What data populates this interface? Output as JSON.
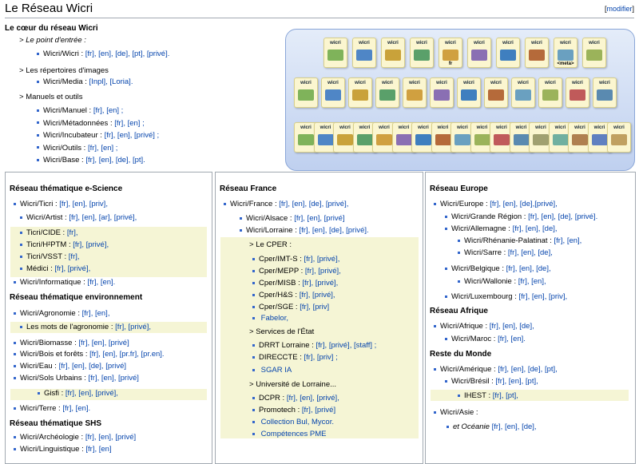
{
  "page": {
    "title": "Le Réseau Wicri",
    "edit_link": "modifier"
  },
  "coeur": {
    "heading": "Le cœur du réseau Wicri",
    "point_label": "Le point d'entrée :",
    "point_items": [
      {
        "name": "Wicri/Wicri :",
        "links": "[fr], [en], [de], [pt], [privé]."
      }
    ],
    "images_label": "Les répertoires d'images",
    "images_items": [
      {
        "name": "Wicri/Media :",
        "links": "[Inpl], [Loria]."
      }
    ],
    "manuels_label": "Manuels et outils",
    "manuels_items": [
      {
        "name": "Wicri/Manuel :",
        "links": "[fr], [en] ;"
      },
      {
        "name": "Wicri/Métadonnées :",
        "links": "[fr], [en] ;"
      },
      {
        "name": "Wicri/Incubateur :",
        "links": "[fr], [en], [privé] ;"
      },
      {
        "name": "Wicri/Outils :",
        "links": "[fr], [en] ;"
      },
      {
        "name": "Wicri/Base :",
        "links": "[fr], [en], [de], [pt]."
      }
    ]
  },
  "collage": {
    "tile_text": "wicri",
    "tile_count": 42,
    "row1_labels": [
      "",
      "",
      "",
      "",
      "fr",
      "",
      "",
      "",
      "<meta>",
      ""
    ],
    "row2_labels": [
      "",
      "",
      "",
      "",
      "",
      "",
      "",
      "",
      "",
      "",
      "",
      ""
    ],
    "row3_labels": [
      "",
      "",
      "",
      "",
      "",
      "",
      "",
      "",
      "",
      "",
      "",
      "",
      "",
      "",
      "",
      "",
      ""
    ],
    "colors": {
      "frame": "#bfd0ef",
      "tile": "#fbf6d0"
    }
  },
  "col1": {
    "h1": "Réseau thématique e-Science",
    "e_items": [
      {
        "name": "Wicri/Ticri :",
        "links": "[fr], [en], [priv],"
      },
      {
        "name": "Wicri/Artist :",
        "links": "[fr], [en], [ar], [privé],"
      },
      {
        "name": "Ticri/CIDE :",
        "links": "[fr],"
      },
      {
        "name": "Ticri/H²PTM :",
        "links": "[fr], [privé],"
      },
      {
        "name": "Ticri/VSST :",
        "links": "[fr],"
      },
      {
        "name": "Médici :",
        "links": "[fr], [privé],"
      },
      {
        "name": "Wicri/Informatique :",
        "links": "[fr], [en]."
      }
    ],
    "h2": "Réseau thématique environnement",
    "env_items": [
      {
        "name": "Wicri/Agronomie :",
        "links": "[fr], [en],"
      },
      {
        "name": "Les mots de l'agronomie :",
        "links": "[fr], [privé],"
      },
      {
        "name": "Wicri/Biomasse :",
        "links": "[fr], [en], [privé]"
      },
      {
        "name": "Wicri/Bois et forêts :",
        "links": "[fr], [en], [pr.fr], [pr.en]."
      },
      {
        "name": "Wicri/Eau :",
        "links": "[fr], [en], [de], [privé]"
      },
      {
        "name": "Wicri/Sols Urbains :",
        "links": "[fr], [en], [privé]"
      },
      {
        "name": "Gisfi :",
        "links": "[fr], [en], [privé],"
      },
      {
        "name": "Wicri/Terre :",
        "links": "[fr], [en]."
      }
    ],
    "h3": "Réseau thématique SHS",
    "shs_items": [
      {
        "name": "Wicri/Archéologie :",
        "links": "[fr], [en], [privé]"
      },
      {
        "name": "Wicri/Linguistique :",
        "links": "[fr], [en]"
      }
    ]
  },
  "col2": {
    "h1": "Réseau France",
    "items": [
      {
        "name": "Wicri/France :",
        "links": "[fr], [en], [de], [privé],"
      },
      {
        "name": "Wicri/Alsace :",
        "links": "[fr], [en], [privé]"
      },
      {
        "name": "Wicri/Lorraine :",
        "links": "[fr], [en], [de], [privé]."
      }
    ],
    "cper_label": "Le CPER :",
    "cper_items": [
      {
        "name": "Cper/IMT-S :",
        "links": "[fr], [privé],"
      },
      {
        "name": "Cper/MEPP :",
        "links": "[fr], [privé],"
      },
      {
        "name": "Cper/MISB :",
        "links": "[fr], [privé],"
      },
      {
        "name": "Cper/H&S :",
        "links": "[fr], [privé],"
      },
      {
        "name": "Cper/SGE :",
        "links": "[fr], [priv]"
      },
      {
        "name": "",
        "links": "Fabelor,"
      }
    ],
    "etat_label": "Services de l'État",
    "etat_items": [
      {
        "name": "DRRT Lorraine :",
        "links": "[fr], [privé], [staff] ;"
      },
      {
        "name": "DIRECCTE :",
        "links": "[fr], [priv] ;"
      },
      {
        "name": "",
        "links": "SGAR IA"
      }
    ],
    "univ_label": "Université de Lorraine...",
    "univ_items": [
      {
        "name": "DCPR :",
        "links": "[fr], [en], [privé],"
      },
      {
        "name": "Promotech :",
        "links": "[fr], [privé]"
      },
      {
        "name": "",
        "links": "Collection Bul, Mycor."
      },
      {
        "name": "",
        "links": "Compétences PME"
      }
    ]
  },
  "col3": {
    "h1": "Réseau Europe",
    "europe_items": [
      {
        "name": "Wicri/Europe :",
        "links": "[fr], [en], [de],[privé],"
      },
      {
        "name": "Wicri/Grande Région :",
        "links": "[fr], [en], [de], [privé]."
      },
      {
        "name": "Wicri/Allemagne :",
        "links": "[fr], [en], [de],"
      },
      {
        "name": "Wicri/Rhénanie-Palatinat :",
        "links": "[fr], [en],"
      },
      {
        "name": "Wicri/Sarre :",
        "links": "[fr], [en], [de],"
      },
      {
        "name": "Wicri/Belgique :",
        "links": "[fr], [en], [de],"
      },
      {
        "name": "Wicri/Wallonie :",
        "links": "[fr], [en],"
      },
      {
        "name": "Wicri/Luxembourg :",
        "links": "[fr], [en], [priv],"
      }
    ],
    "h2": "Réseau Afrique",
    "afrique_items": [
      {
        "name": "Wicri/Afrique :",
        "links": "[fr], [en], [de],"
      },
      {
        "name": "Wicri/Maroc :",
        "links": "[fr], [en]."
      }
    ],
    "h3": "Reste du Monde",
    "monde_items": [
      {
        "name": "Wicri/Amérique :",
        "links": "[fr], [en], [de], [pt],"
      },
      {
        "name": "Wicri/Brésil :",
        "links": "[fr], [en], [pt],"
      },
      {
        "name": "IHEST :",
        "links": "[fr], [pt],"
      },
      {
        "name": "Wicri/Asie :",
        "links": ""
      },
      {
        "name": "et Océanie",
        "links": "[fr], [en], [de],"
      }
    ]
  }
}
